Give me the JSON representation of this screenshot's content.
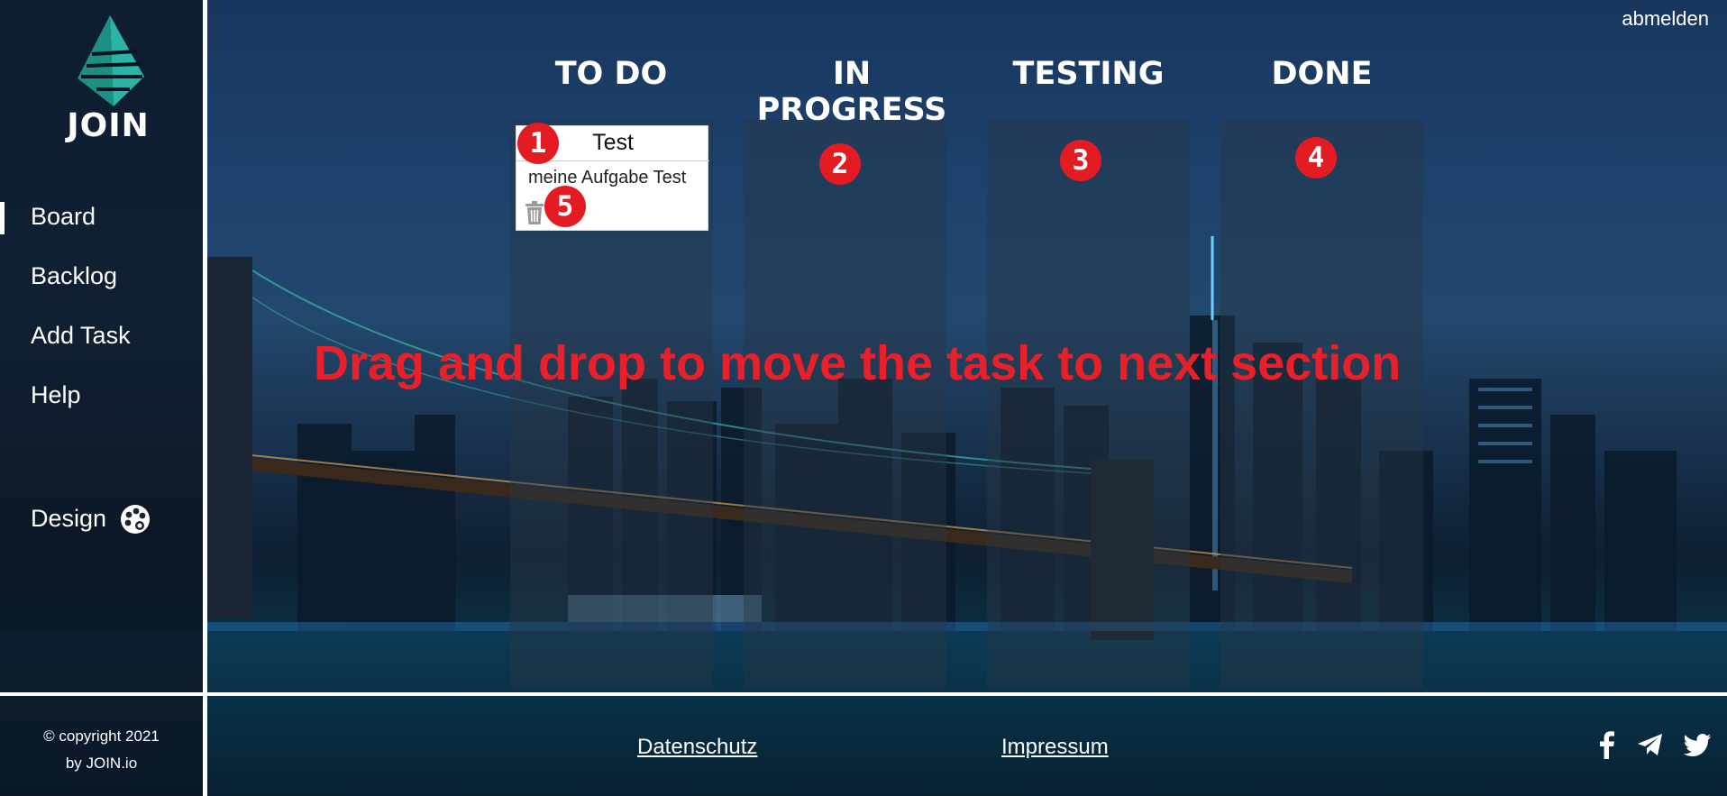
{
  "app": {
    "logo_text": "JOIN"
  },
  "header": {
    "logout_label": "abmelden"
  },
  "sidebar": {
    "items": [
      {
        "label": "Board",
        "active": true
      },
      {
        "label": "Backlog",
        "active": false
      },
      {
        "label": "Add Task",
        "active": false
      },
      {
        "label": "Help",
        "active": false
      }
    ],
    "design_label": "Design",
    "copyright_line1": "© copyright 2021",
    "copyright_line2": "by JOIN.io"
  },
  "board": {
    "columns": [
      {
        "title": "TO DO"
      },
      {
        "title": "IN PROGRESS"
      },
      {
        "title": "TESTING"
      },
      {
        "title": "DONE"
      }
    ],
    "tasks": [
      {
        "title": "Test",
        "description": "meine Aufgabe Test",
        "column": "TO DO"
      }
    ]
  },
  "annotations": {
    "badges": [
      "1",
      "2",
      "3",
      "4",
      "5"
    ],
    "hint": "Drag and drop to move the task to next section",
    "color": "#e31b23"
  },
  "footer": {
    "links": [
      {
        "label": "Datenschutz"
      },
      {
        "label": "Impressum"
      }
    ],
    "social": [
      "facebook-icon",
      "telegram-icon",
      "twitter-icon"
    ]
  }
}
